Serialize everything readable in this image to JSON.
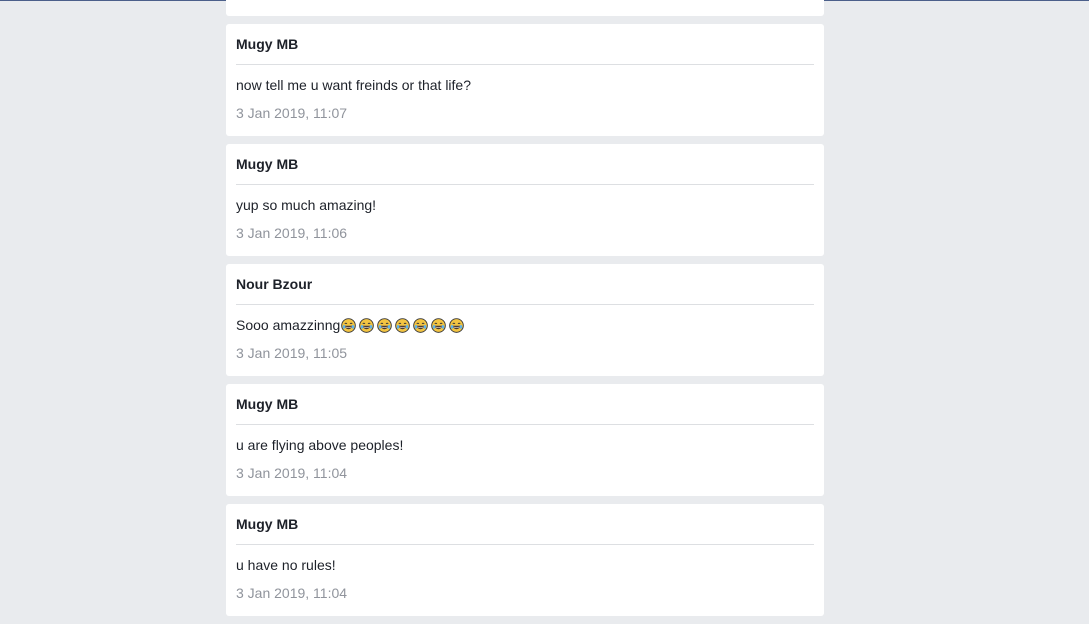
{
  "messages": [
    {
      "author": "",
      "text": "",
      "time": ""
    },
    {
      "author": "Mugy MB",
      "text": "now tell me u want freinds or that life?",
      "time": "3 Jan 2019, 11:07"
    },
    {
      "author": "Mugy MB",
      "text": "yup so much amazing!",
      "time": "3 Jan 2019, 11:06"
    },
    {
      "author": "Nour Bzour",
      "text": "Sooo amazzinng",
      "emoji": "😂😂😂😂😂😂😂",
      "time": "3 Jan 2019, 11:05"
    },
    {
      "author": "Mugy MB",
      "text": "u are flying above peoples!",
      "time": "3 Jan 2019, 11:04"
    },
    {
      "author": "Mugy MB",
      "text": "u have no rules!",
      "time": "3 Jan 2019, 11:04"
    }
  ]
}
